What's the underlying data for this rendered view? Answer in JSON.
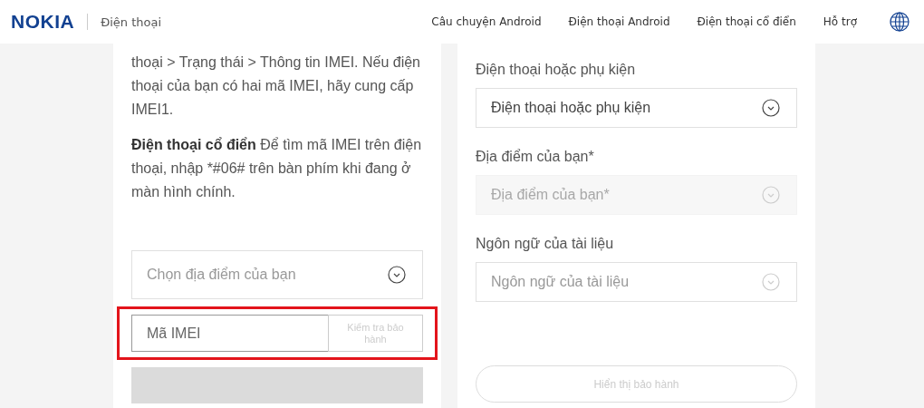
{
  "header": {
    "logo": "NOKIA",
    "section": "Điện thoại",
    "nav": [
      "Câu chuyện Android",
      "Điện thoại Android",
      "Điện thoại cổ điển",
      "Hỗ trợ"
    ]
  },
  "left_card": {
    "paragraphs": [
      "thoại > Trạng thái > Thông tin IMEI. Nếu điện thoại của bạn có hai mã IMEI, hãy cung cấp IMEI1.",
      "**Điện thoại cổ điển** Để tìm mã IMEI trên điện thoại, nhập *#06# trên bàn phím khi đang ở màn hình chính."
    ],
    "location_select": {
      "placeholder": "Chọn địa điểm của bạn"
    },
    "imei_form": {
      "highlighted": true,
      "input": {
        "placeholder": "Mã IMEI"
      },
      "button": {
        "label": "Kiểm tra bảo hành",
        "disabled": true
      }
    }
  },
  "right_card": {
    "fields": [
      {
        "label": "Điện thoại hoặc phụ kiện",
        "select": {
          "value": "Điện thoại hoặc phụ kiện",
          "disabled": false
        }
      },
      {
        "label": "Địa điểm của bạn*",
        "select": {
          "placeholder": "Địa điểm của bạn*",
          "disabled": true
        }
      },
      {
        "label": "Ngôn ngữ của tài liệu",
        "select": {
          "placeholder": "Ngôn ngữ của tài liệu",
          "disabled": false
        }
      }
    ],
    "button": {
      "label": "Hiển thị bảo hành",
      "disabled": true
    }
  }
}
